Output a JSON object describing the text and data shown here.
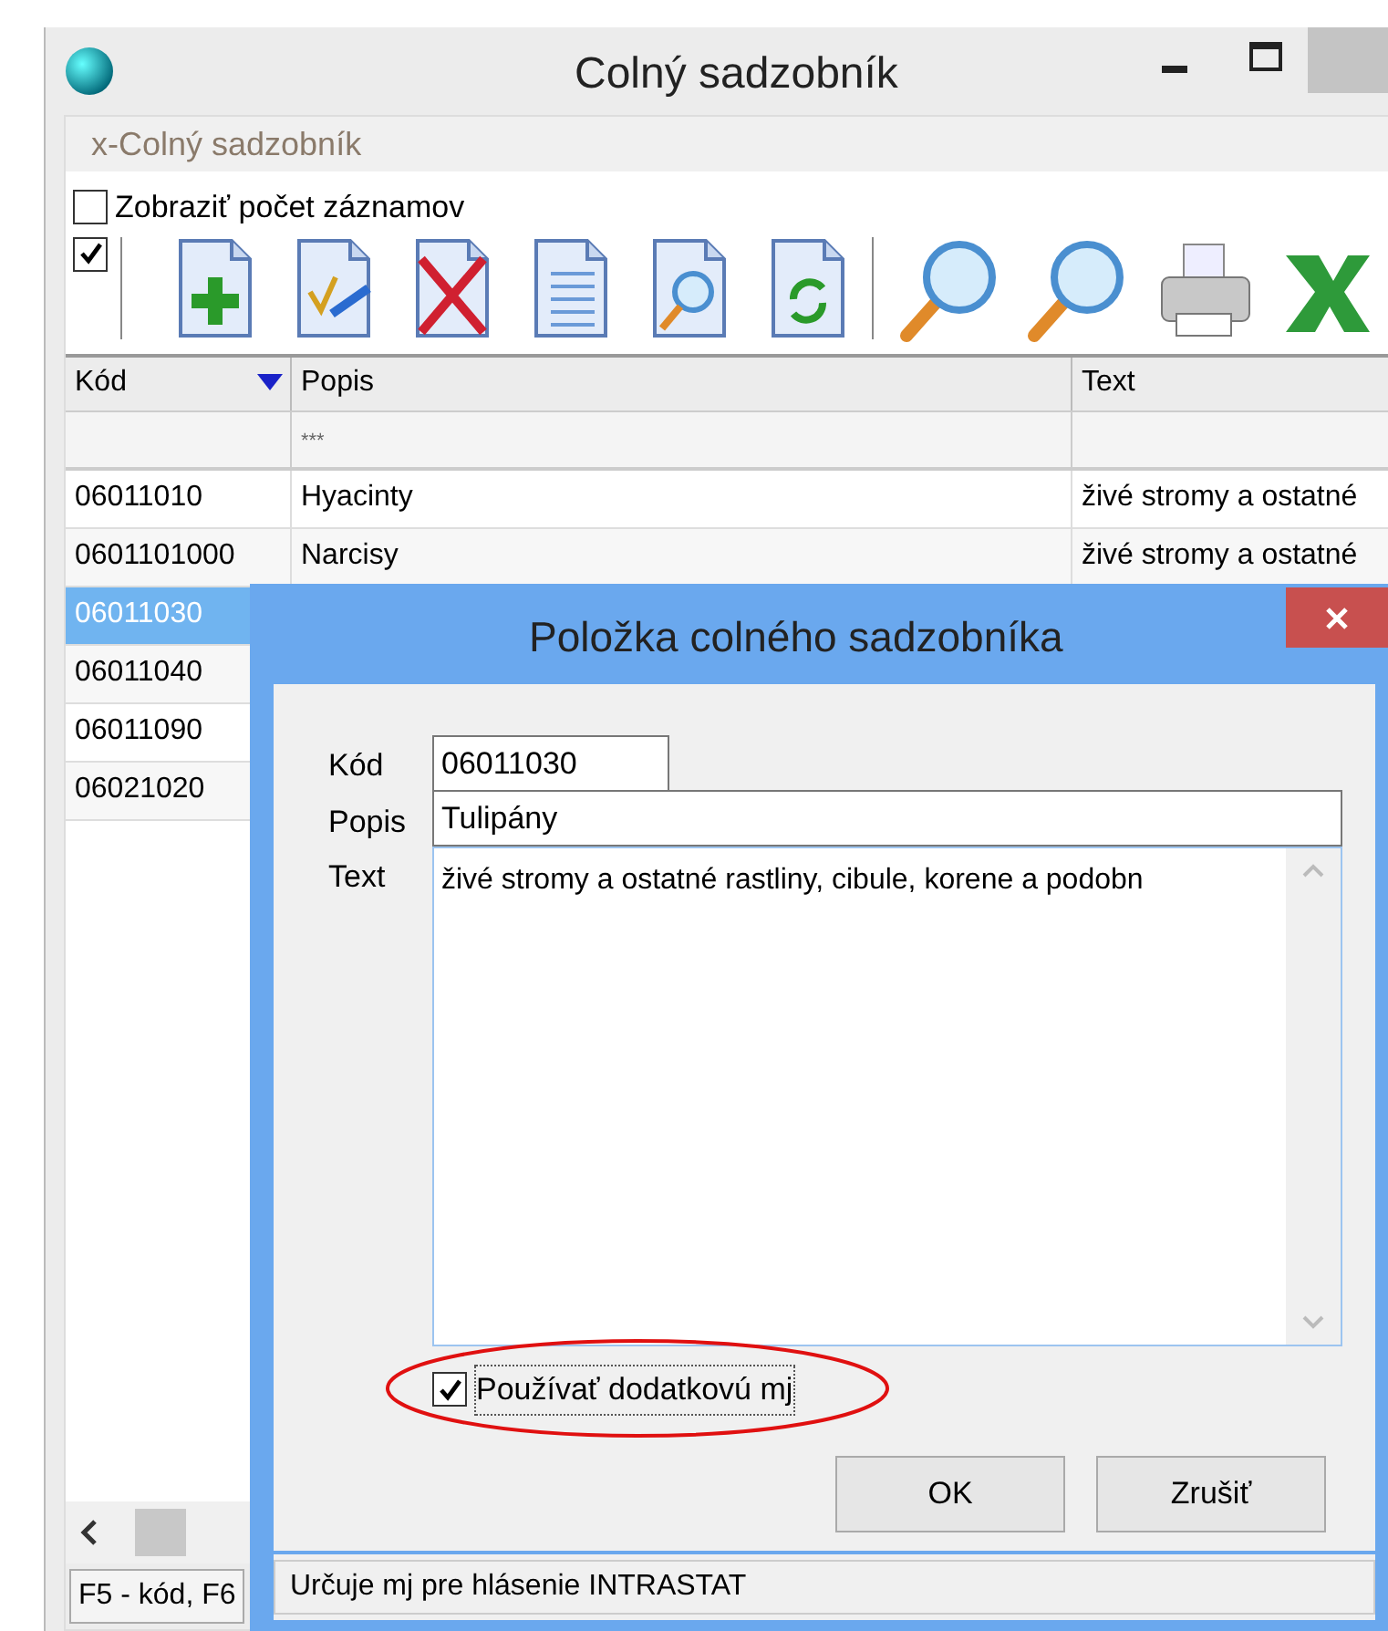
{
  "window": {
    "title": "Colný sadzobník"
  },
  "panel_title": "x-Colný sadzobník",
  "show_count": {
    "label": "Zobraziť počet záznamov",
    "checked": false
  },
  "toolbar": {
    "checked": true
  },
  "table": {
    "columns": [
      "Kód",
      "Popis",
      "Text"
    ],
    "filter": "***",
    "rows": [
      {
        "code": "06011010",
        "description": "Hyacinty",
        "text": "živé stromy a ostatné",
        "selected": false
      },
      {
        "code": "0601101000",
        "description": "Narcisy",
        "text": "živé stromy a ostatné",
        "selected": false
      },
      {
        "code": "06011030",
        "selected": true
      },
      {
        "code": "06011040",
        "selected": false
      },
      {
        "code": "06011090",
        "selected": false
      },
      {
        "code": "06021020",
        "selected": false
      }
    ]
  },
  "status_bar": "F5 - kód, F6",
  "dialog": {
    "title": "Položka colného sadzobníka",
    "fields": [
      {
        "kind": "short",
        "label": "Kód",
        "value": "06011030"
      },
      {
        "kind": "line",
        "label": "Popis",
        "value": "Tulipány"
      },
      {
        "kind": "area",
        "label": "Text",
        "value": "živé stromy a ostatné rastliny, cibule, korene a podobn"
      }
    ],
    "checkbox": {
      "label": "Používať dodatkovú mj",
      "checked": true
    },
    "buttons": [
      "OK",
      "Zrušiť"
    ],
    "status_bar": "Určuje mj pre hlásenie INTRASTAT"
  }
}
